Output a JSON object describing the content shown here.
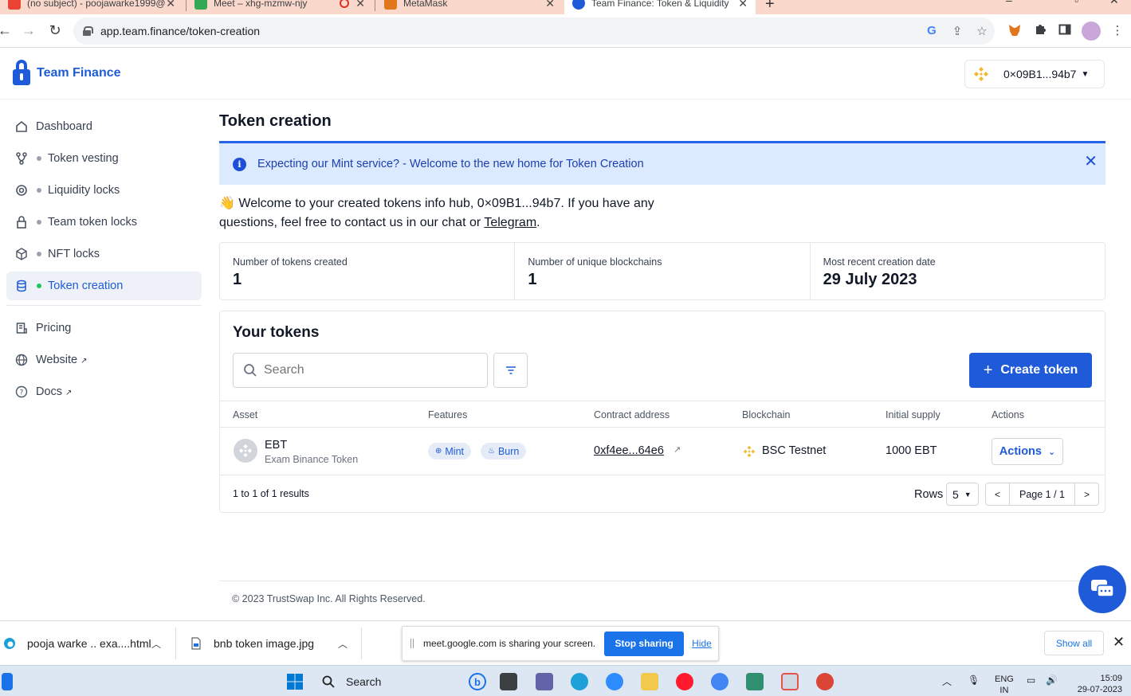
{
  "browser": {
    "tabs": [
      {
        "title": "(no subject) - poojawarke1999@",
        "active": false
      },
      {
        "title": "Meet – xhg-mzmw-njy",
        "active": false
      },
      {
        "title": "MetaMask",
        "active": false
      },
      {
        "title": "Team Finance: Token & Liquidity",
        "active": true
      }
    ],
    "new_tab": "+",
    "url": "app.team.finance/token-creation"
  },
  "app": {
    "brand": "Team Finance",
    "wallet_address": "0×09B1...94b7",
    "sidebar": {
      "items": [
        {
          "label": "Dashboard",
          "icon": "home-icon"
        },
        {
          "label": "Token vesting",
          "icon": "vesting-icon"
        },
        {
          "label": "Liquidity locks",
          "icon": "liquidity-icon"
        },
        {
          "label": "Team token locks",
          "icon": "lock-icon"
        },
        {
          "label": "NFT locks",
          "icon": "cube-icon"
        },
        {
          "label": "Token creation",
          "icon": "database-icon",
          "active": true
        }
      ],
      "links": [
        {
          "label": "Pricing",
          "icon": "pricing-icon"
        },
        {
          "label": "Website",
          "icon": "globe-icon"
        },
        {
          "label": "Docs",
          "icon": "help-icon"
        }
      ]
    },
    "page_title": "Token creation",
    "alert": {
      "message": "Expecting our Mint service? - Welcome to the new home for Token Creation",
      "close": "✕"
    },
    "welcome": {
      "emoji": "👋",
      "text": "Welcome to your created tokens info hub, 0×09B1...94b7. If you have any questions, feel free to contact us in our chat or ",
      "link": "Telegram",
      "suffix": "."
    },
    "stats": [
      {
        "label": "Number of tokens created",
        "value": "1"
      },
      {
        "label": "Number of unique blockchains",
        "value": "1"
      },
      {
        "label": "Most recent creation date",
        "value": "29 July 2023"
      }
    ],
    "tokens": {
      "heading": "Your tokens",
      "search_placeholder": "Search",
      "create_label": "Create token",
      "columns": [
        "Asset",
        "Features",
        "Contract address",
        "Blockchain",
        "Initial supply",
        "Actions"
      ],
      "rows": [
        {
          "symbol": "EBT",
          "name": "Exam Binance Token",
          "features": [
            "Mint",
            "Burn"
          ],
          "contract": "0xf4ee...64e6",
          "blockchain": "BSC Testnet",
          "supply": "1000 EBT",
          "action_label": "Actions"
        }
      ],
      "results": "1 to 1 of 1 results",
      "rows_label": "Rows",
      "rows_value": "5",
      "page_label": "Page 1 / 1"
    },
    "footer": "© 2023 TrustSwap Inc. All Rights Reserved."
  },
  "downloads": {
    "items": [
      {
        "name": "pooja warke .. exa....html"
      },
      {
        "name": "bnb token image.jpg"
      }
    ],
    "share": {
      "text": "meet.google.com is sharing your screen.",
      "stop": "Stop sharing",
      "hide": "Hide"
    },
    "show_all": "Show all"
  },
  "taskbar": {
    "search": "Search",
    "lang_top": "ENG",
    "lang_bottom": "IN",
    "time": "15:09",
    "date": "29-07-2023"
  },
  "colors": {
    "brand": "#1f5bd8",
    "alert_bg": "#dbeafe",
    "active_dot": "#22c55e",
    "bnb": "#f3ba2f"
  }
}
